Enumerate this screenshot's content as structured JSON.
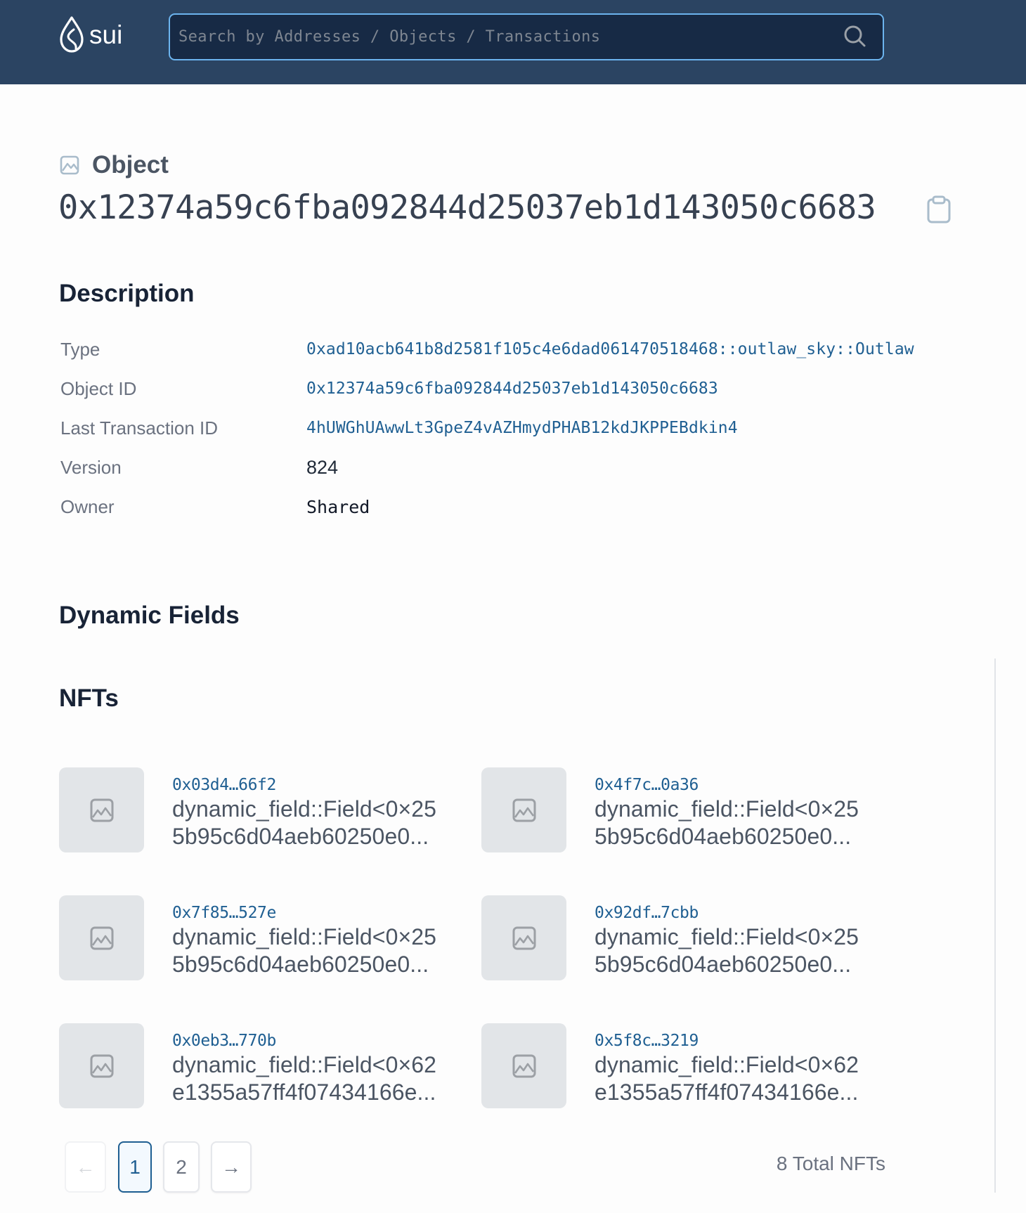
{
  "header": {
    "logo_text": "sui",
    "search_placeholder": "Search by Addresses / Objects / Transactions",
    "search_value": ""
  },
  "object": {
    "label": "Object",
    "id": "0x12374a59c6fba092844d25037eb1d143050c6683"
  },
  "description": {
    "title": "Description",
    "rows": [
      {
        "label": "Type",
        "value": "0xad10acb641b8d2581f105c4e6dad061470518468::outlaw_sky::Outlaw"
      },
      {
        "label": "Object ID",
        "value": "0x12374a59c6fba092844d25037eb1d143050c6683"
      },
      {
        "label": "Last Transaction ID",
        "value": "4hUWGhUAwwLt3GpeZ4vAZHmydPHAB12kdJKPPEBdkin4"
      },
      {
        "label": "Version",
        "value": "824"
      },
      {
        "label": "Owner",
        "value": "Shared"
      }
    ]
  },
  "dynamic_fields": {
    "title": "Dynamic Fields"
  },
  "nfts": {
    "title": "NFTs",
    "items": [
      {
        "id": "0x03d4…66f2",
        "type_line1": "dynamic_field::Field<0×25",
        "type_line2": "5b95c6d04aeb60250e0..."
      },
      {
        "id": "0x4f7c…0a36",
        "type_line1": "dynamic_field::Field<0×25",
        "type_line2": "5b95c6d04aeb60250e0..."
      },
      {
        "id": "0x7f85…527e",
        "type_line1": "dynamic_field::Field<0×25",
        "type_line2": "5b95c6d04aeb60250e0..."
      },
      {
        "id": "0x92df…7cbb",
        "type_line1": "dynamic_field::Field<0×25",
        "type_line2": "5b95c6d04aeb60250e0..."
      },
      {
        "id": "0x0eb3…770b",
        "type_line1": "dynamic_field::Field<0×62",
        "type_line2": "e1355a57ff4f07434166e..."
      },
      {
        "id": "0x5f8c…3219",
        "type_line1": "dynamic_field::Field<0×62",
        "type_line2": "e1355a57ff4f07434166e..."
      }
    ],
    "pagination": {
      "prev": "←",
      "pages": [
        "1",
        "2"
      ],
      "current": "1",
      "next": "→"
    },
    "total_label": "8 Total NFTs"
  },
  "colors": {
    "header_bg": "#2b4462",
    "search_bg": "#172a45",
    "search_border": "#6cb4ee",
    "link": "#1f5f92"
  }
}
